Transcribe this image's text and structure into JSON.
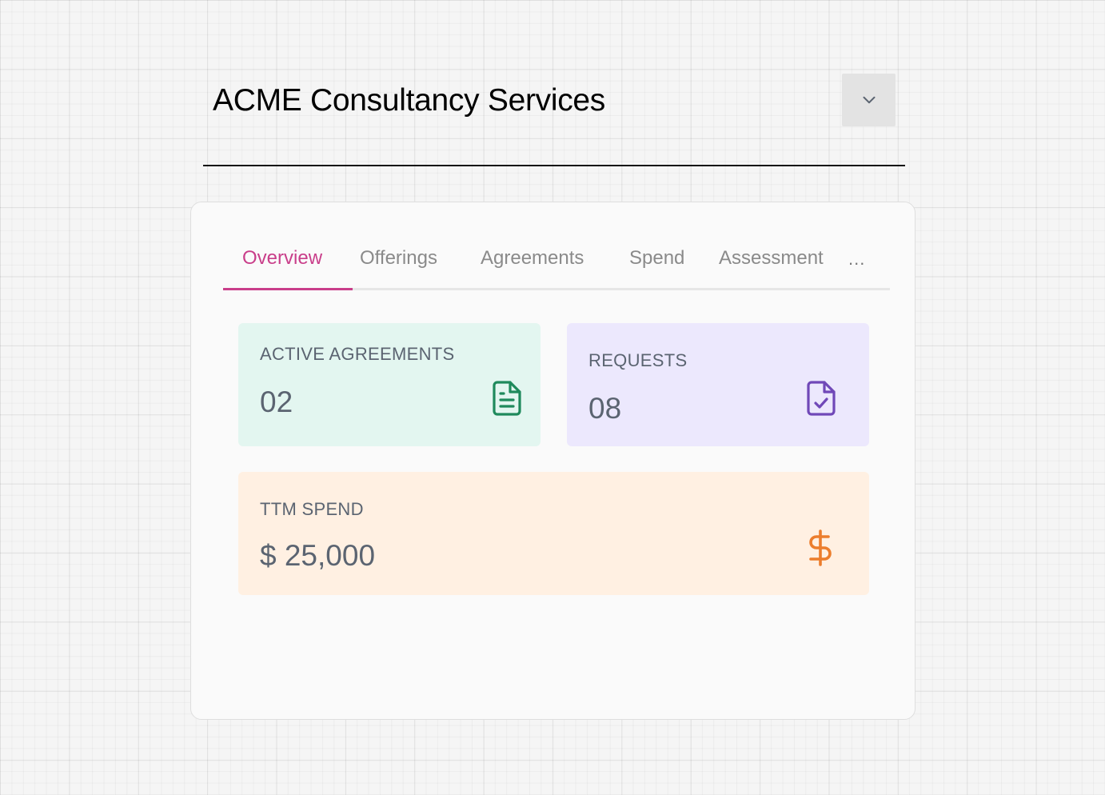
{
  "header": {
    "title": "ACME Consultancy Services",
    "dropdown_icon": "chevron-down-icon"
  },
  "tabs": [
    {
      "label": "Overview",
      "active": true
    },
    {
      "label": "Offerings",
      "active": false
    },
    {
      "label": "Agreements",
      "active": false
    },
    {
      "label": "Spend",
      "active": false
    },
    {
      "label": "Assessment",
      "active": false
    }
  ],
  "tabs_more": "...",
  "cards": {
    "active_agreements": {
      "label": "ACTIVE AGREEMENTS",
      "value": "02",
      "icon": "document-icon",
      "bg": "#e3f6f0",
      "accent": "#1f8a5c"
    },
    "requests": {
      "label": "REQUESTS",
      "value": "08",
      "icon": "document-check-icon",
      "bg": "#ece8fd",
      "accent": "#7048b8"
    },
    "ttm_spend": {
      "label": "TTM SPEND",
      "value": "$ 25,000",
      "icon": "dollar-icon",
      "bg": "#fff0e2",
      "accent": "#ec7d2c"
    }
  },
  "colors": {
    "active_tab": "#c93e8a",
    "text_muted": "#5b6471"
  }
}
